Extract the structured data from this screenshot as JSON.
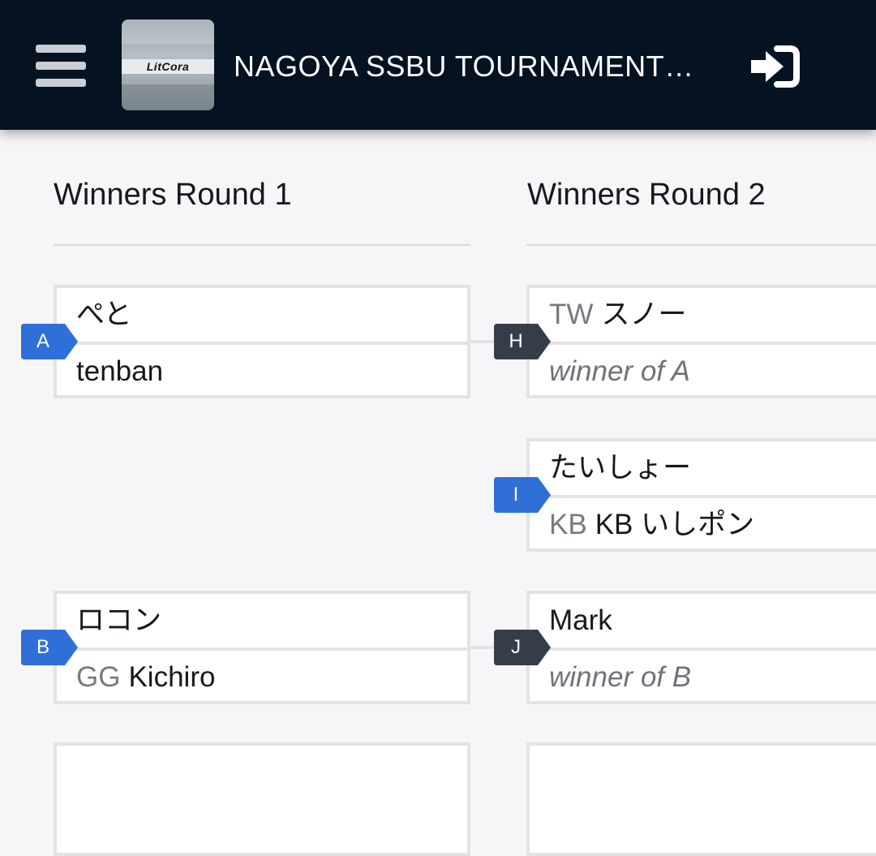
{
  "header": {
    "title": "NAGOYA SSBU TOURNAMENT…",
    "logo_text": "LitCora",
    "menu_icon": "hamburger-menu-icon",
    "signin_icon": "sign-in-icon"
  },
  "colors": {
    "header_bg": "#051221",
    "tag_blue": "#2f6fd8",
    "tag_dark": "#363d4a",
    "page_bg": "#f6f6f8"
  },
  "rounds": [
    {
      "title": "Winners Round 1",
      "matches": [
        {
          "id": "A",
          "top": {
            "prefix": "",
            "name": "ぺと"
          },
          "bottom": {
            "prefix": "",
            "name": "tenban"
          }
        },
        {
          "id": "B",
          "top": {
            "prefix": "",
            "name": "ロコン"
          },
          "bottom": {
            "prefix": "GG",
            "name": "Kichiro"
          }
        }
      ]
    },
    {
      "title": "Winners Round 2",
      "matches": [
        {
          "id": "H",
          "top": {
            "prefix": "TW",
            "name": "スノー"
          },
          "bottom": {
            "placeholder": "winner of A"
          }
        },
        {
          "id": "I",
          "top": {
            "prefix": "",
            "name": "たいしょー"
          },
          "bottom": {
            "prefix": "KB",
            "name": "KB いしポン"
          }
        },
        {
          "id": "J",
          "top": {
            "prefix": "",
            "name": "Mark"
          },
          "bottom": {
            "placeholder": "winner of B"
          }
        }
      ]
    }
  ]
}
